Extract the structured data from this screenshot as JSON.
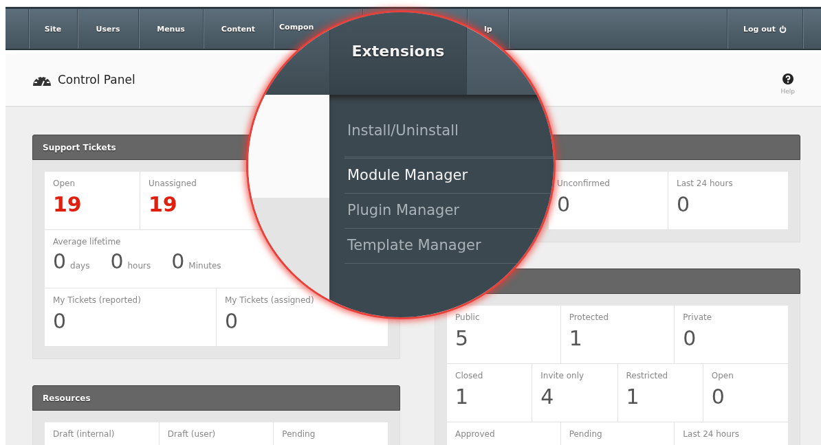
{
  "nav": {
    "items": [
      {
        "label": "Site"
      },
      {
        "label": "Users"
      },
      {
        "label": "Menus"
      },
      {
        "label": "Content"
      },
      {
        "label": "Compon"
      }
    ],
    "cut_item": "lp",
    "logout": "Log out"
  },
  "header": {
    "title": "Control Panel",
    "help": "Help"
  },
  "magnifier": {
    "tabs": [
      {
        "label": "Extensions",
        "selected": true
      }
    ],
    "menu": [
      {
        "label": "Install/Uninstall",
        "highlighted": false
      },
      {
        "label": "Module Manager",
        "highlighted": true
      },
      {
        "label": "Plugin Manager",
        "highlighted": false
      },
      {
        "label": "Template Manager",
        "highlighted": false
      }
    ]
  },
  "left_panels": [
    {
      "title": "Support Tickets",
      "rows": [
        {
          "kind": "stats",
          "cells": [
            {
              "label": "Open",
              "value": "19",
              "highlight": true
            },
            {
              "label": "Unassigned",
              "value": "19",
              "highlight": true
            }
          ]
        },
        {
          "kind": "duration",
          "label": "Average lifetime",
          "parts": [
            {
              "value": "0",
              "unit": "days"
            },
            {
              "value": "0",
              "unit": "hours"
            },
            {
              "value": "0",
              "unit": "Minutes"
            }
          ]
        },
        {
          "kind": "stats",
          "cells": [
            {
              "label": "My Tickets (reported)",
              "value": "0",
              "highlight": false
            },
            {
              "label": "My Tickets (assigned)",
              "value": "0",
              "highlight": false
            }
          ]
        }
      ]
    },
    {
      "title": "Resources",
      "rows": [
        {
          "kind": "stats",
          "cells": [
            {
              "label": "Draft (internal)"
            },
            {
              "label": "Draft (user)"
            },
            {
              "label": "Pending"
            }
          ]
        }
      ]
    }
  ],
  "right_panels": [
    {
      "rows": [
        {
          "kind": "stats",
          "cells": [
            {
              "label": "Unconfirmed",
              "value": "0",
              "highlight": false
            },
            {
              "label": "Last 24 hours",
              "value": "0",
              "highlight": false
            }
          ]
        }
      ]
    },
    {
      "rows": [
        {
          "kind": "stats",
          "cells": [
            {
              "label": "Public",
              "value": "5",
              "highlight": false
            },
            {
              "label": "Protected",
              "value": "1",
              "highlight": false
            },
            {
              "label": "Private",
              "value": "0",
              "highlight": false
            }
          ]
        },
        {
          "kind": "stats",
          "cells": [
            {
              "label": "Closed",
              "value": "1",
              "highlight": false
            },
            {
              "label": "Invite only",
              "value": "4",
              "highlight": false
            },
            {
              "label": "Restricted",
              "value": "1",
              "highlight": false
            },
            {
              "label": "Open",
              "value": "0",
              "highlight": false
            }
          ]
        },
        {
          "kind": "stats",
          "cells": [
            {
              "label": "Approved"
            },
            {
              "label": "Pending"
            },
            {
              "label": "Last 24 hours"
            }
          ]
        }
      ]
    }
  ]
}
